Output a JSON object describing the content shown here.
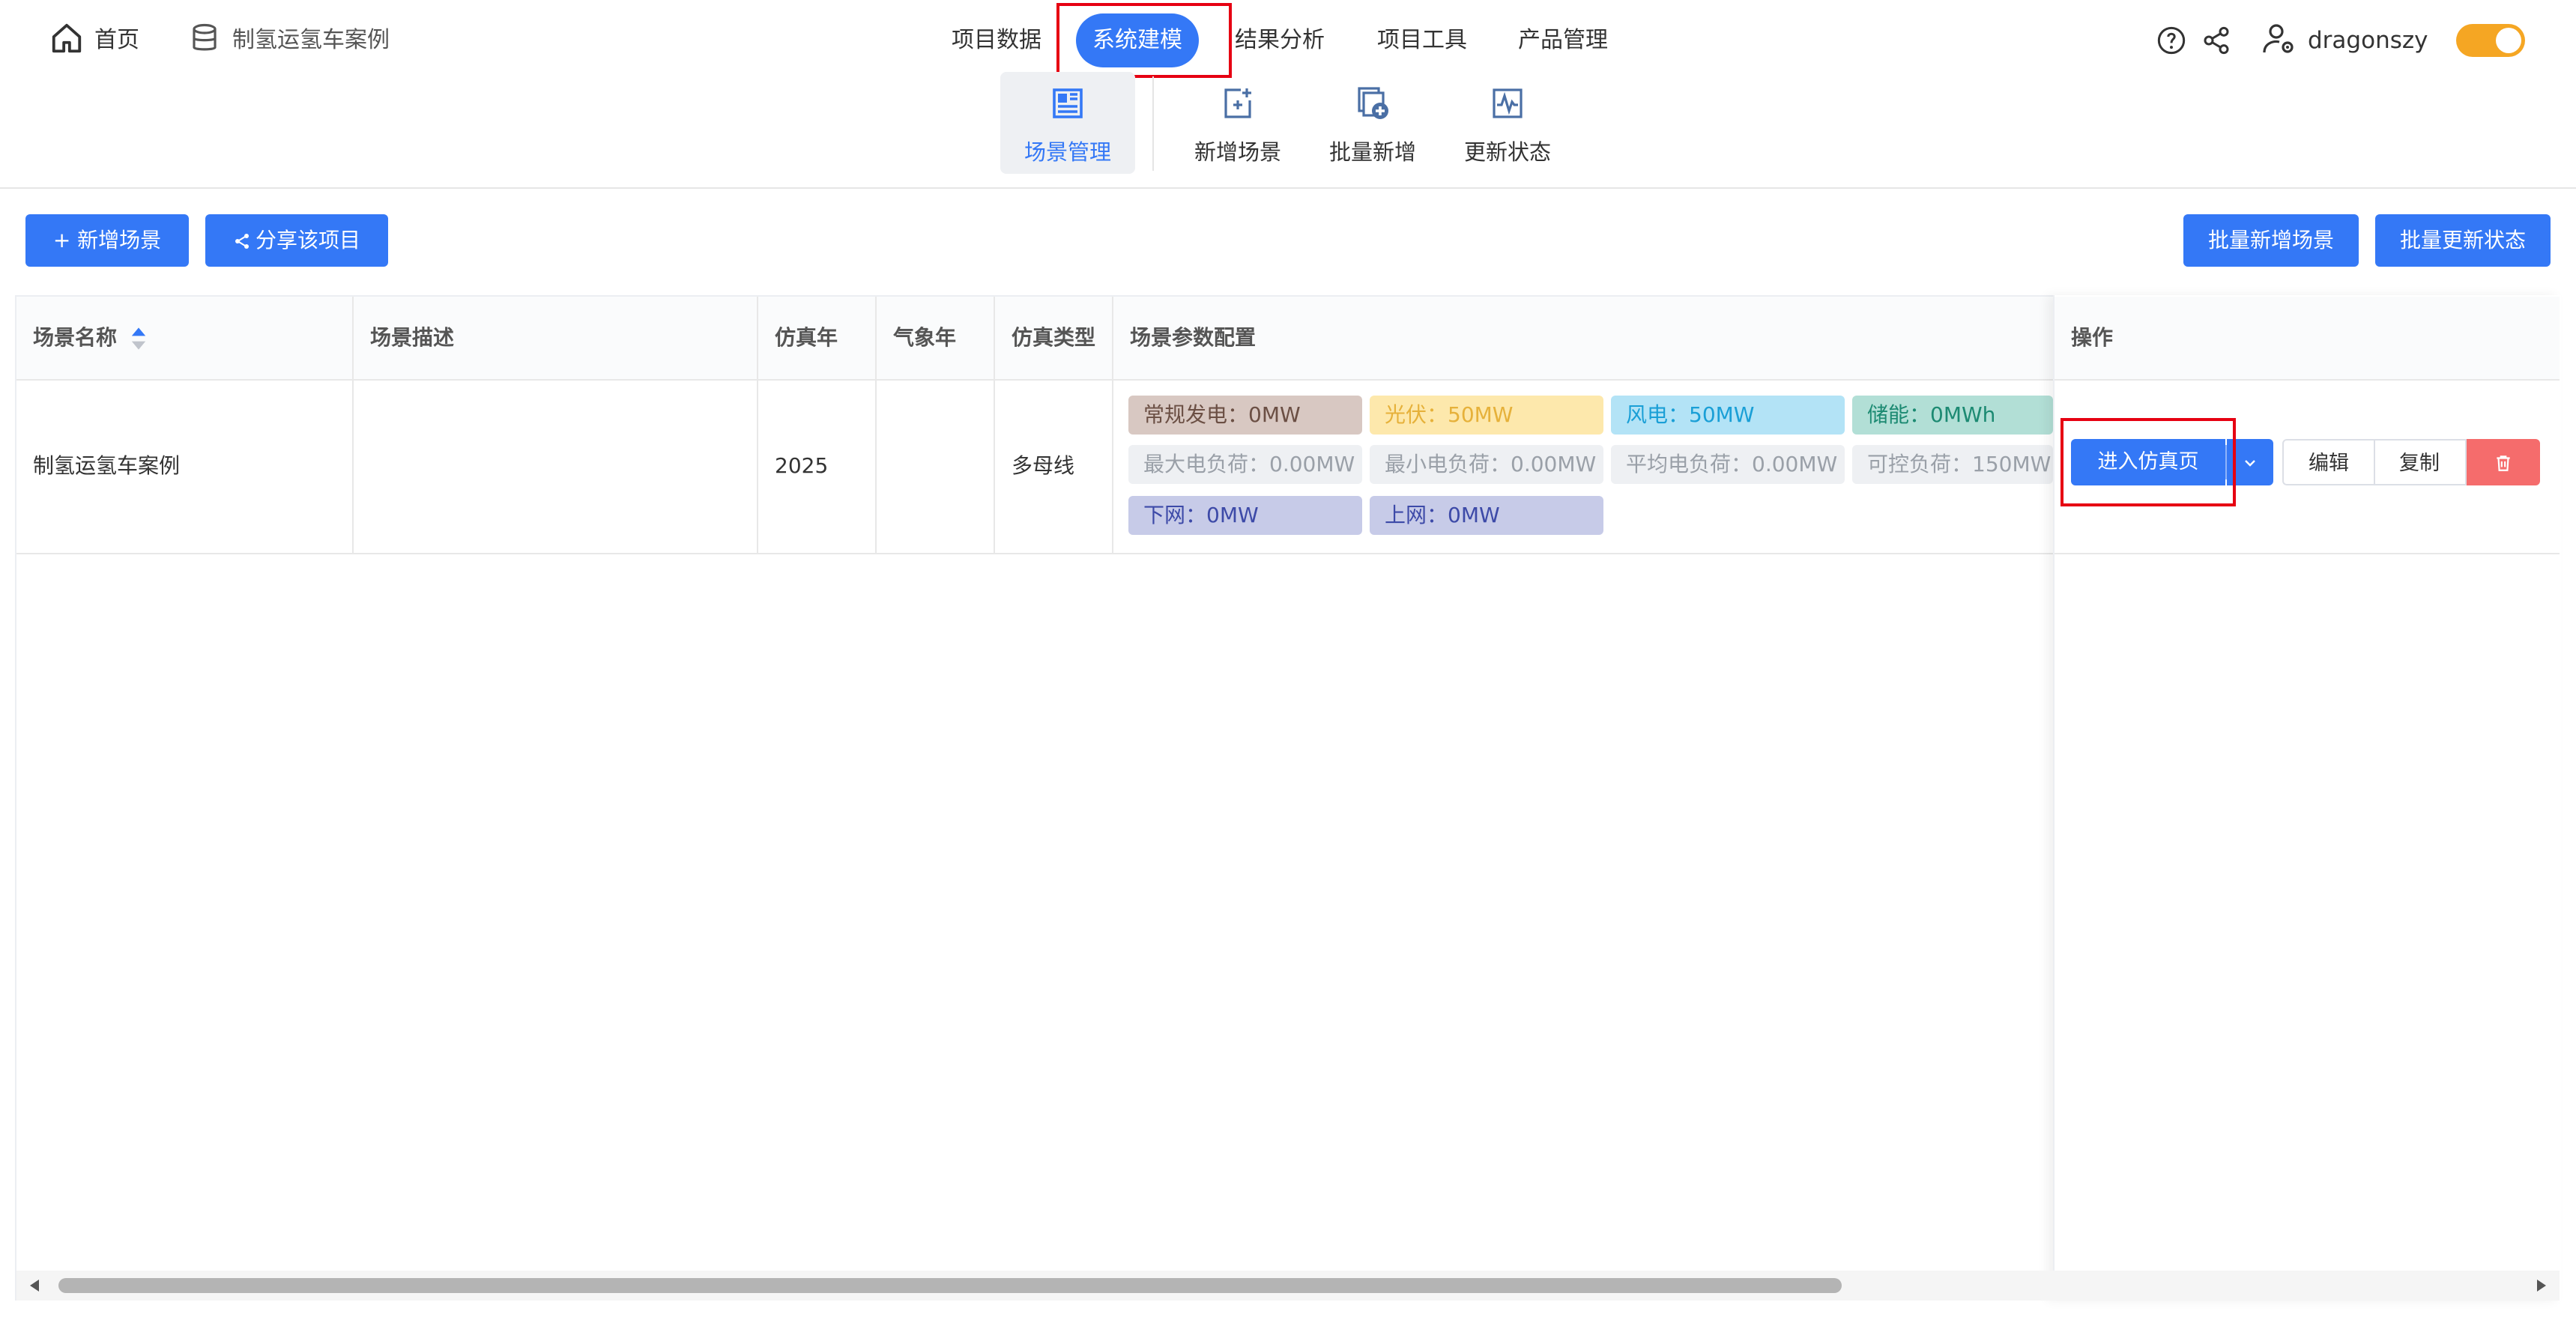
{
  "top_nav": {
    "home_label": "首页",
    "project_label": "制氢运氢车案例",
    "menu": [
      "项目数据",
      "系统建模",
      "结果分析",
      "项目工具",
      "产品管理"
    ],
    "username": "dragonszy"
  },
  "sub_nav": [
    "场景管理",
    "新增场景",
    "批量新增",
    "更新状态"
  ],
  "toolbar": {
    "add_scene": "+ 新增场景",
    "share_project": "分享该项目",
    "batch_add": "批量新增场景",
    "batch_update": "批量更新状态"
  },
  "table": {
    "headers": [
      "场景名称",
      "场景描述",
      "仿真年",
      "气象年",
      "仿真类型",
      "场景参数配置",
      "操作"
    ],
    "row": {
      "name": "制氢运氢车案例",
      "description": "",
      "sim_year": "2025",
      "weather_year": "",
      "sim_type": "多母线",
      "tags": [
        "常规发电：0MW",
        "光伏：50MW",
        "风电：50MW",
        "储能：0MWh",
        "最大电负荷：0.00MW",
        "最小电负荷：0.00MW",
        "平均电负荷：0.00MW",
        "可控负荷：150MW",
        "下网：0MW",
        "上网：0MW"
      ],
      "actions": {
        "enter": "进入仿真页",
        "edit": "编辑",
        "copy": "复制"
      }
    }
  },
  "colors": {
    "accent": "#3478f6",
    "danger": "#f56c6c",
    "toggle": "#f5a623",
    "highlight": "#e60012"
  }
}
